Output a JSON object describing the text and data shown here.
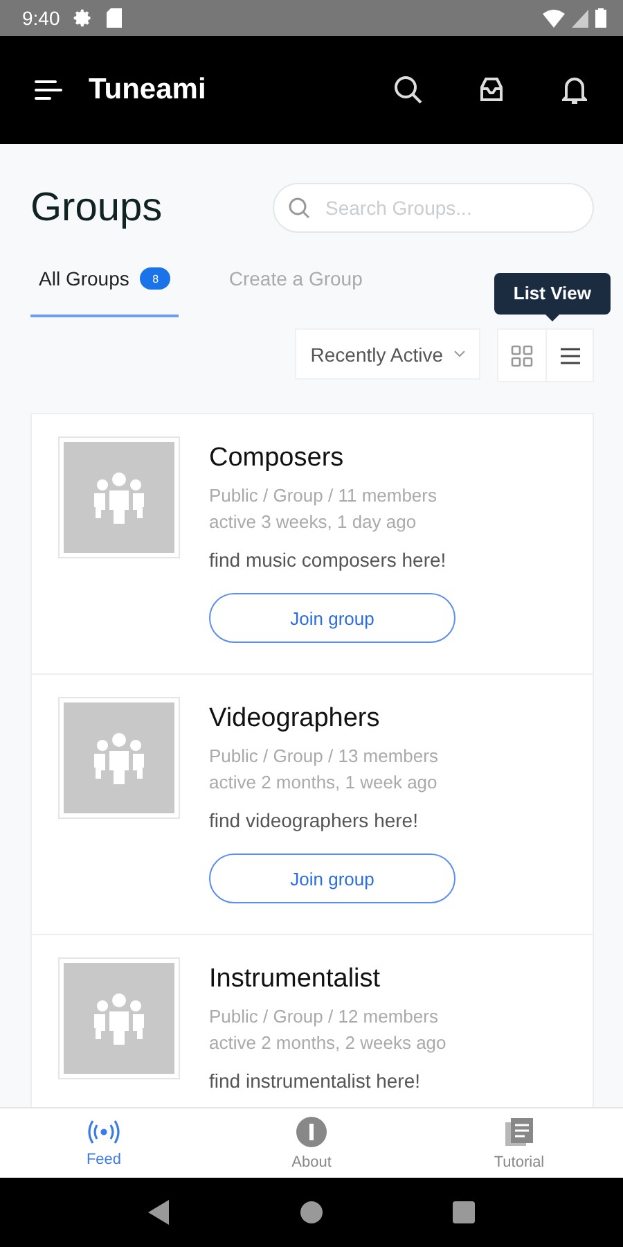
{
  "status_bar": {
    "time": "9:40"
  },
  "app_bar": {
    "title": "Tuneami"
  },
  "page": {
    "title": "Groups",
    "search": {
      "placeholder": "Search Groups..."
    }
  },
  "tabs": [
    {
      "label": "All Groups",
      "badge": "8",
      "selected": true
    },
    {
      "label": "Create a Group",
      "selected": false
    }
  ],
  "sort": {
    "value": "Recently Active"
  },
  "view_toggle": {
    "tooltip": "List View",
    "options": [
      {
        "kind": "grid",
        "selected": false
      },
      {
        "kind": "list",
        "selected": true
      }
    ]
  },
  "groups": [
    {
      "name": "Composers",
      "meta": "Public / Group / 11 members",
      "activity": "active 3 weeks, 1 day ago",
      "description": "find music composers here!",
      "button": "Join group"
    },
    {
      "name": "Videographers",
      "meta": "Public / Group / 13 members",
      "activity": "active 2 months, 1 week ago",
      "description": "find videographers here!",
      "button": "Join group"
    },
    {
      "name": "Instrumentalist",
      "meta": "Public / Group / 12 members",
      "activity": "active 2 months, 2 weeks ago",
      "description": "find instrumentalist here!"
    }
  ],
  "bottom_nav": [
    {
      "kind": "feed",
      "label": "Feed",
      "selected": true
    },
    {
      "kind": "about",
      "label": "About",
      "selected": false
    },
    {
      "kind": "tutorial",
      "label": "Tutorial",
      "selected": false
    }
  ]
}
